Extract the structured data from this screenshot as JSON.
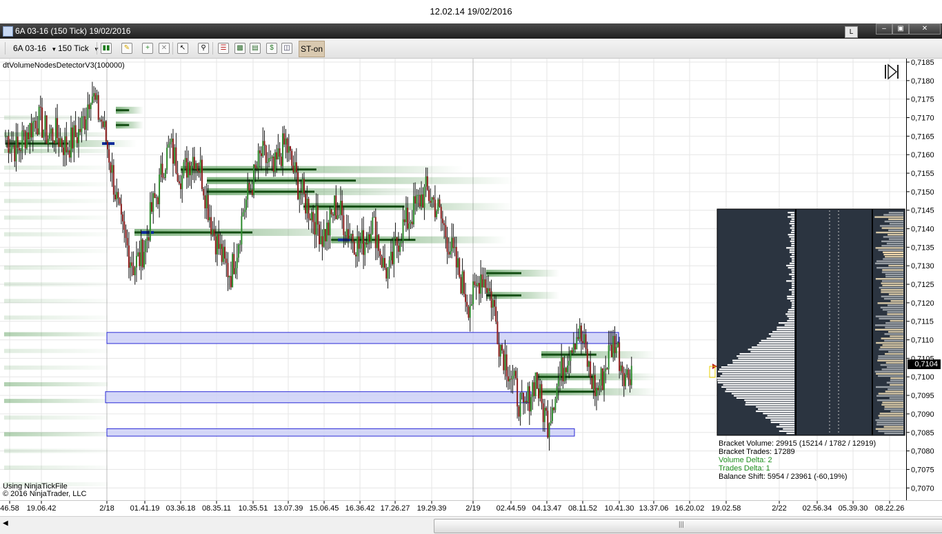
{
  "window": {
    "caption": "12.02.14 19/02/2016",
    "title": "6A 03-16 (150 Tick)  19/02/2016",
    "l_button": "L",
    "minimize": "–",
    "restore": "▣",
    "close": "✕"
  },
  "toolbar": {
    "instrument": "6A 03-16",
    "interval": "150 Tick",
    "st_label": "ST-on"
  },
  "chart": {
    "indicator_label": "dtVolumeNodesDetectorV3(100000)",
    "note_using": "Using NinjaTickFile",
    "note_copyright": "© 2016 NinjaTrader, LLC",
    "current_price": "0,7104",
    "accent": "#1f7a1f",
    "zone_fill": "#ccd0f7",
    "zone_stroke": "#2a2ad6"
  },
  "chart_data": {
    "type": "candlestick",
    "ylim": [
      0.7068,
      0.7185
    ],
    "y_ticks": [
      "0,7185",
      "0,7180",
      "0,7175",
      "0,7170",
      "0,7165",
      "0,7160",
      "0,7155",
      "0,7150",
      "0,7145",
      "0,7140",
      "0,7135",
      "0,7130",
      "0,7125",
      "0,7120",
      "0,7115",
      "0,7110",
      "0,7105",
      "0,7100",
      "0,7095",
      "0,7090",
      "0,7085",
      "0,7080",
      "0,7075",
      "0,7070"
    ],
    "x_ticks": [
      "46.58",
      "19.06.42",
      "2/18",
      "01.41.19",
      "03.36.18",
      "08.35.11",
      "10.35.51",
      "13.07.39",
      "15.06.45",
      "16.36.42",
      "17.26.27",
      "19.29.39",
      "2/19",
      "02.44.59",
      "04.13.47",
      "08.11.52",
      "10.41.30",
      "13.37.06",
      "16.20.02",
      "19.02.58",
      "2/22",
      "02.56.34",
      "05.39.30",
      "08.22.26"
    ],
    "price_path": [
      0.7165,
      0.7163,
      0.7161,
      0.7165,
      0.7167,
      0.717,
      0.7168,
      0.7165,
      0.7166,
      0.7164,
      0.7162,
      0.7164,
      0.7166,
      0.717,
      0.7178,
      0.7172,
      0.7168,
      0.716,
      0.715,
      0.714,
      0.7135,
      0.713,
      0.7132,
      0.7136,
      0.7145,
      0.715,
      0.7158,
      0.7162,
      0.7158,
      0.7154,
      0.7158,
      0.716,
      0.7156,
      0.7148,
      0.714,
      0.7135,
      0.713,
      0.7128,
      0.7135,
      0.7145,
      0.715,
      0.7155,
      0.716,
      0.7158,
      0.7155,
      0.716,
      0.7163,
      0.7157,
      0.7152,
      0.7148,
      0.7145,
      0.7142,
      0.7138,
      0.714,
      0.7146,
      0.7144,
      0.714,
      0.7138,
      0.7135,
      0.7137,
      0.7142,
      0.7138,
      0.713,
      0.7128,
      0.7135,
      0.714,
      0.7142,
      0.7145,
      0.7148,
      0.715,
      0.7148,
      0.7145,
      0.714,
      0.7135,
      0.713,
      0.7125,
      0.712,
      0.7122,
      0.7128,
      0.7125,
      0.712,
      0.711,
      0.7105,
      0.71,
      0.7095,
      0.709,
      0.7095,
      0.71,
      0.7092,
      0.7088,
      0.7095,
      0.71,
      0.7105,
      0.711,
      0.7112,
      0.7108,
      0.71,
      0.7096,
      0.71,
      0.7106,
      0.711,
      0.7104,
      0.71,
      0.7104
    ],
    "volume_nodes": [
      0.7163,
      0.7172,
      0.7168,
      0.7156,
      0.7153,
      0.715,
      0.7146,
      0.7139,
      0.7137,
      0.7128,
      0.7122,
      0.7106,
      0.71,
      0.7096
    ],
    "zones": [
      {
        "from": 0.7112,
        "to": 0.7109
      },
      {
        "from": 0.7096,
        "to": 0.7093
      },
      {
        "from": 0.7086,
        "to": 0.7084
      }
    ]
  },
  "stats": {
    "bracket_volume": "Bracket Volume: 29915 (15214 / 1782 / 12919)",
    "bracket_trades": "Bracket Trades: 17289",
    "volume_delta": "Volume Delta: 2",
    "trades_delta": "Trades Delta: 1",
    "balance_shift": "Balance Shift: 5954 / 23961 (-60,19%)"
  }
}
